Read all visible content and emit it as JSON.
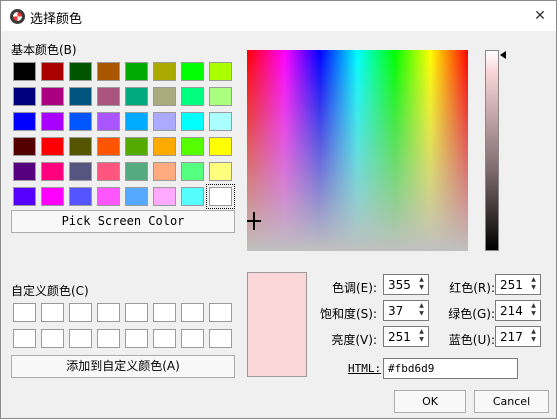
{
  "window": {
    "title": "选择颜色",
    "close_glyph": "✕"
  },
  "basic_colors": {
    "label": "基本颜色(B)",
    "swatches": [
      "#000000",
      "#aa0000",
      "#005500",
      "#aa5500",
      "#00aa00",
      "#aaaa00",
      "#00ff00",
      "#aaff00",
      "#00007f",
      "#aa007f",
      "#00557f",
      "#aa557f",
      "#00aa7f",
      "#aaaa7f",
      "#00ff7f",
      "#aaff7f",
      "#0000ff",
      "#aa00ff",
      "#0055ff",
      "#aa55ff",
      "#00aaff",
      "#aaaaff",
      "#00ffff",
      "#aaffff",
      "#550000",
      "#ff0000",
      "#555500",
      "#ff5500",
      "#55aa00",
      "#ffaa00",
      "#55ff00",
      "#ffff00",
      "#55007f",
      "#ff007f",
      "#55557f",
      "#ff557f",
      "#55aa7f",
      "#ffaa7f",
      "#55ff7f",
      "#ffff7f",
      "#5500ff",
      "#ff00ff",
      "#5555ff",
      "#ff55ff",
      "#55aaff",
      "#ffaaff",
      "#55ffff",
      "#ffffff"
    ],
    "selected_index": 47
  },
  "pick_screen_button": "Pick Screen Color",
  "custom_colors": {
    "label": "自定义颜色(C)",
    "count": 16
  },
  "add_custom_button": "添加到自定义颜色(A)",
  "fields": {
    "hue": {
      "label": "色调(E):",
      "value": "355"
    },
    "sat": {
      "label": "饱和度(S):",
      "value": "37"
    },
    "val": {
      "label": "亮度(V):",
      "value": "251"
    },
    "red": {
      "label": "红色(R):",
      "value": "251"
    },
    "green": {
      "label": "绿色(G):",
      "value": "214"
    },
    "blue": {
      "label": "蓝色(U):",
      "value": "217"
    }
  },
  "html": {
    "label": "HTML:",
    "value": "#fbd6d9"
  },
  "current_color": "#fbd6d9",
  "buttons": {
    "ok": "OK",
    "cancel": "Cancel"
  }
}
